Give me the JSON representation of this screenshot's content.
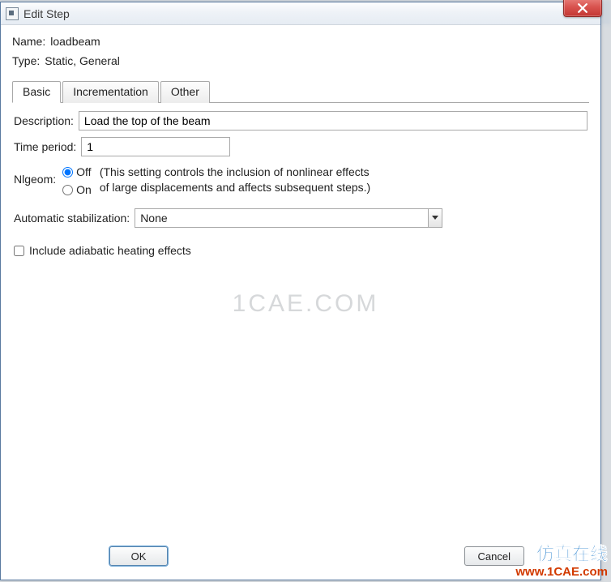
{
  "window": {
    "title": "Edit Step"
  },
  "fields": {
    "name_label": "Name:",
    "name_value": "loadbeam",
    "type_label": "Type:",
    "type_value": "Static, General"
  },
  "tabs": {
    "basic": "Basic",
    "incrementation": "Incrementation",
    "other": "Other"
  },
  "basic": {
    "description_label": "Description:",
    "description_value": "Load the top of the beam",
    "time_label": "Time period:",
    "time_value": "1",
    "nlgeom_label": "Nlgeom:",
    "nlgeom_off": "Off",
    "nlgeom_on": "On",
    "nlgeom_selected": "Off",
    "nlgeom_help1": "(This setting controls the inclusion of nonlinear effects",
    "nlgeom_help2": "of large displacements and affects subsequent steps.)",
    "stab_label": "Automatic stabilization:",
    "stab_value": "None",
    "adiabatic_label": "Include adiabatic heating effects",
    "adiabatic_checked": false
  },
  "buttons": {
    "ok": "OK",
    "cancel": "Cancel"
  },
  "watermark": {
    "center": "1CAE.COM",
    "cn": "仿真在线",
    "url": "www.1CAE.com"
  }
}
